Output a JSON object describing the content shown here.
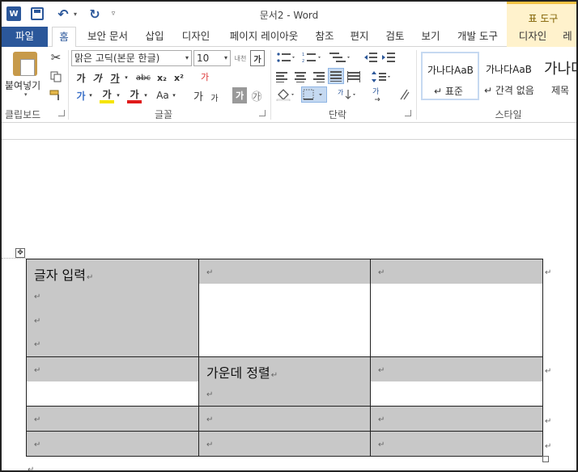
{
  "window": {
    "title": "문서2 - Word",
    "word_logo": "W",
    "undo_icon": "↶",
    "redo_icon": "↻",
    "dropdown_glyph": "▾",
    "qat_more_glyph": "▿",
    "contextual_tools": "표 도구"
  },
  "tabs": {
    "file": "파일",
    "home": "홈",
    "security": "보안 문서",
    "insert": "삽입",
    "design": "디자인",
    "layout": "페이지 레이아웃",
    "references": "참조",
    "mailings": "편지",
    "review": "검토",
    "view": "보기",
    "developer": "개발 도구",
    "table_design": "디자인",
    "table_layout": "레"
  },
  "ribbon": {
    "clipboard": {
      "paste": "붙여넣기",
      "label": "클립보드"
    },
    "font": {
      "font_name": "맑은 고딕(본문 한글)",
      "font_size": "10",
      "phonetic": "내천",
      "bold": "가",
      "italic": "가",
      "underline": "가",
      "strikethrough": "abc",
      "subscript": "x₂",
      "superscript": "x²",
      "text_effects": "가",
      "highlight": "가",
      "font_color": "가",
      "change_case": "Aa",
      "grow_font": "가",
      "shrink_font": "가",
      "char_shading": "가",
      "enclosed_char": "㉮",
      "clear_format": "가",
      "label": "글꼴"
    },
    "paragraph": {
      "label": "단락"
    },
    "styles": {
      "preview": "가나다AaB",
      "preview_large": "가나다",
      "normal": "↵ 표준",
      "no_spacing": "↵ 간격 없음",
      "heading1": "제목",
      "label": "스타일"
    }
  },
  "document": {
    "move_handle": "✥",
    "paragraph_mark": "↵",
    "cells": {
      "r1c1": "글자 입력",
      "r2c2": "가운데 정렬"
    }
  },
  "colors": {
    "accent": "#2b579a",
    "context_tab": "#fff2cc",
    "cell_shading": "#c8c8c8"
  }
}
